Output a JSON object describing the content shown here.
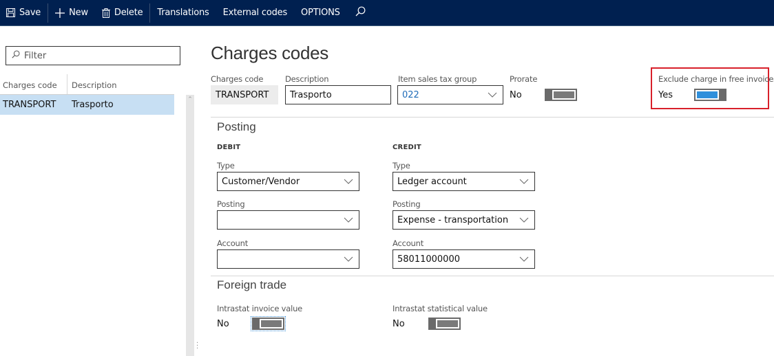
{
  "actionbar": {
    "save": "Save",
    "new": "New",
    "delete": "Delete",
    "translations": "Translations",
    "external_codes": "External codes",
    "options": "OPTIONS",
    "icons": {
      "save": "save-icon",
      "new": "plus-icon",
      "delete": "trash-icon",
      "search": "search-icon"
    }
  },
  "list": {
    "filter_placeholder": "Filter",
    "columns": [
      "Charges code",
      "Description"
    ],
    "rows": [
      {
        "code": "TRANSPORT",
        "description": "Trasporto",
        "selected": true
      }
    ]
  },
  "page": {
    "title": "Charges codes"
  },
  "header_fields": {
    "charges_code": {
      "label": "Charges code",
      "value": "TRANSPORT"
    },
    "description": {
      "label": "Description",
      "value": "Trasporto"
    },
    "item_sales_tax_group": {
      "label": "Item sales tax group",
      "value": "022"
    },
    "prorate": {
      "label": "Prorate",
      "value": "No",
      "on": false
    },
    "exclude_charge": {
      "label": "Exclude charge in free invoices",
      "value": "Yes",
      "on": true
    }
  },
  "posting": {
    "title": "Posting",
    "debit": {
      "heading": "DEBIT",
      "type": {
        "label": "Type",
        "value": "Customer/Vendor"
      },
      "posting": {
        "label": "Posting",
        "value": ""
      },
      "account": {
        "label": "Account",
        "value": ""
      }
    },
    "credit": {
      "heading": "CREDIT",
      "type": {
        "label": "Type",
        "value": "Ledger account"
      },
      "posting": {
        "label": "Posting",
        "value": "Expense - transportation"
      },
      "account": {
        "label": "Account",
        "value": "58011000000"
      }
    }
  },
  "foreign_trade": {
    "title": "Foreign trade",
    "intrastat_invoice_value": {
      "label": "Intrastat invoice value",
      "value": "No",
      "on": false
    },
    "intrastat_statistical_value": {
      "label": "Intrastat statistical value",
      "value": "No",
      "on": false
    }
  },
  "colors": {
    "actionbar_bg": "#002050",
    "selected_row": "#c7dff3",
    "toggle_on": "#2f8fdb",
    "highlight": "#d8202a",
    "link_value": "#1f6bb8"
  }
}
